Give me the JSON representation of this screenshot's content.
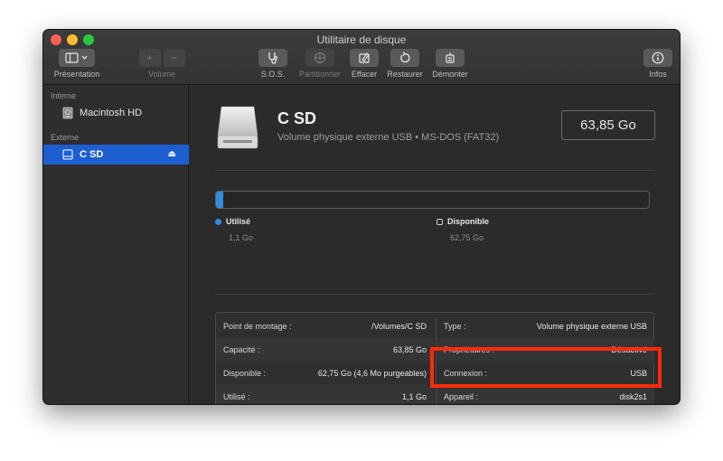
{
  "window": {
    "title": "Utilitaire de disque"
  },
  "toolbar": {
    "presentation_label": "Présentation",
    "volume_label": "Volume",
    "sos_label": "S.O.S.",
    "partition_label": "Partitionner",
    "erase_label": "Effacer",
    "restore_label": "Restaurer",
    "unmount_label": "Démonter",
    "info_label": "Infos",
    "add_symbol": "+",
    "remove_symbol": "−"
  },
  "sidebar": {
    "internal_header": "Interne",
    "internal_items": [
      {
        "label": "Macintosh HD"
      }
    ],
    "external_header": "Externe",
    "external_items": [
      {
        "label": "C SD",
        "selected": true
      }
    ]
  },
  "volume": {
    "name": "C SD",
    "subtitle": "Volume physique externe USB • MS-DOS (FAT32)",
    "capacity": "63,85 Go"
  },
  "usage": {
    "used_fraction": 0.017,
    "used_label": "Utilisé",
    "used_value": "1,1 Go",
    "used_color": "#2e8de0",
    "free_label": "Disponible",
    "free_value": "62,75 Go",
    "free_color": "#d0d0d0"
  },
  "info": {
    "left": [
      {
        "key": "Point de montage :",
        "value": "/Volumes/C SD"
      },
      {
        "key": "Capacité :",
        "value": "63,85 Go"
      },
      {
        "key": "Disponible :",
        "value": "62,75 Go (4,6 Mo purgeables)"
      },
      {
        "key": "Utilisé :",
        "value": "1,1 Go"
      }
    ],
    "right": [
      {
        "key": "Type :",
        "value": "Volume physique externe USB"
      },
      {
        "key": "Propriétaires :",
        "value": "Désactivé"
      },
      {
        "key": "Connexion :",
        "value": "USB"
      },
      {
        "key": "Appareil :",
        "value": "disk2s1"
      }
    ]
  },
  "colors": {
    "accent": "#1d5fd0",
    "highlight": "#ff2a0a"
  }
}
